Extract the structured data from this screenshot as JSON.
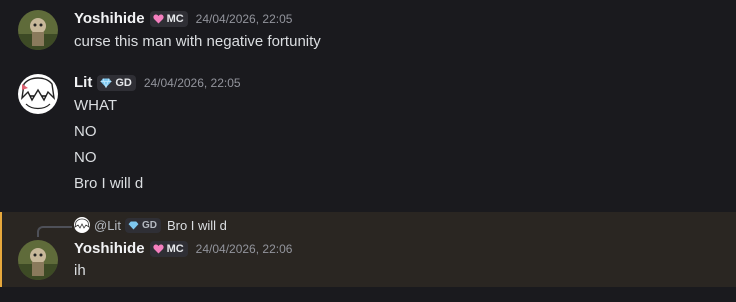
{
  "messages": [
    {
      "username": "Yoshihide",
      "tag": "MC",
      "tag_icon": "heart-icon",
      "timestamp": "24/04/2026, 22:05",
      "lines": [
        "curse this man with negative fortunity"
      ]
    },
    {
      "username": "Lit",
      "tag": "GD",
      "tag_icon": "diamond-icon",
      "timestamp": "24/04/2026, 22:05",
      "lines": [
        "WHAT",
        "NO",
        "NO",
        "Bro I will d"
      ]
    },
    {
      "username": "Yoshihide",
      "tag": "MC",
      "tag_icon": "heart-icon",
      "timestamp": "24/04/2026, 22:06",
      "lines": [
        "ih"
      ],
      "reply": {
        "mention": "@Lit",
        "tag": "GD",
        "tag_icon": "diamond-icon",
        "text": "Bro I will d"
      }
    }
  ],
  "colors": {
    "background": "#1a1a1e",
    "highlight": "#2a2622",
    "highlight_bar": "#e6a83c",
    "heart_tag": "#f47fbf",
    "diamond_tag": "#7ec8f0"
  }
}
